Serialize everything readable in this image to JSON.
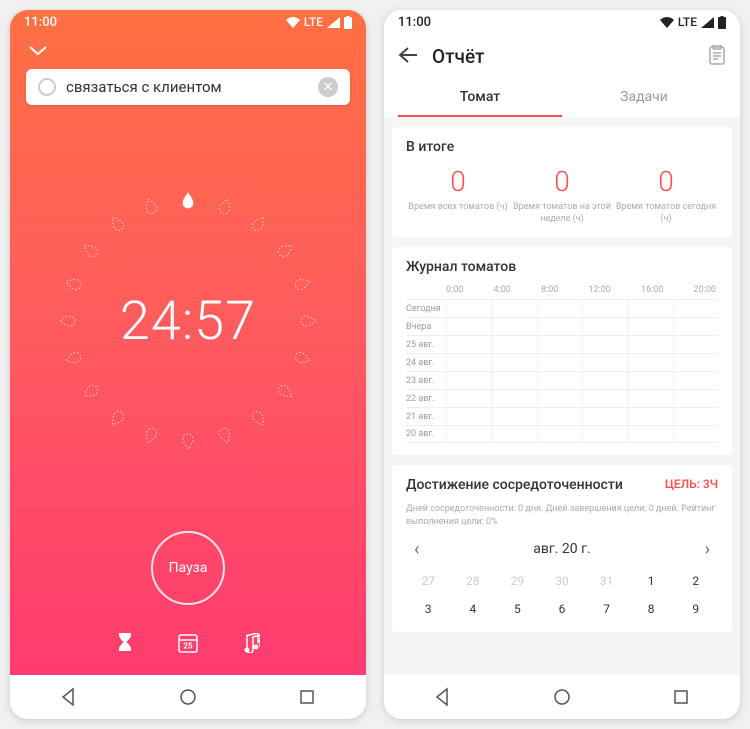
{
  "status": {
    "time": "11:00",
    "network": "LTE"
  },
  "timer": {
    "task_text": "связаться с клиентом",
    "time": "24:57",
    "pause_label": "Пауза"
  },
  "report": {
    "title": "Отчёт",
    "tabs": [
      "Томат",
      "Задачи"
    ],
    "active_tab": 0,
    "summary": {
      "heading": "В итоге",
      "stats": [
        {
          "value": "0",
          "label": "Время всех томатов (ч)"
        },
        {
          "value": "0",
          "label": "Время томатов на этой неделе (ч)"
        },
        {
          "value": "0",
          "label": "Время томатов сегодня (ч)"
        }
      ]
    },
    "journal": {
      "heading": "Журнал томатов",
      "times": [
        "0:00",
        "4:00",
        "8:00",
        "12:00",
        "16:00",
        "20:00"
      ],
      "days": [
        "Сегодня",
        "Вчера",
        "25 авг.",
        "24 авг.",
        "23 авг.",
        "22 авг.",
        "21 авг.",
        "20 авг."
      ]
    },
    "focus": {
      "heading": "Достижение сосредоточенности",
      "text": "Дней сосредоточенности: 0 дня. Дней завершения цели: 0 дней. Рейтинг выполнения цели: 0%",
      "goal": "ЦЕЛЬ: 3Ч"
    },
    "calendar": {
      "month": "авг. 20 г.",
      "rows": [
        [
          {
            "n": "27",
            "dim": true
          },
          {
            "n": "28",
            "dim": true
          },
          {
            "n": "29",
            "dim": true
          },
          {
            "n": "30",
            "dim": true
          },
          {
            "n": "31",
            "dim": true
          },
          {
            "n": "1"
          },
          {
            "n": "2"
          }
        ],
        [
          {
            "n": "3"
          },
          {
            "n": "4"
          },
          {
            "n": "5"
          },
          {
            "n": "6"
          },
          {
            "n": "7"
          },
          {
            "n": "8"
          },
          {
            "n": "9"
          }
        ]
      ]
    }
  }
}
